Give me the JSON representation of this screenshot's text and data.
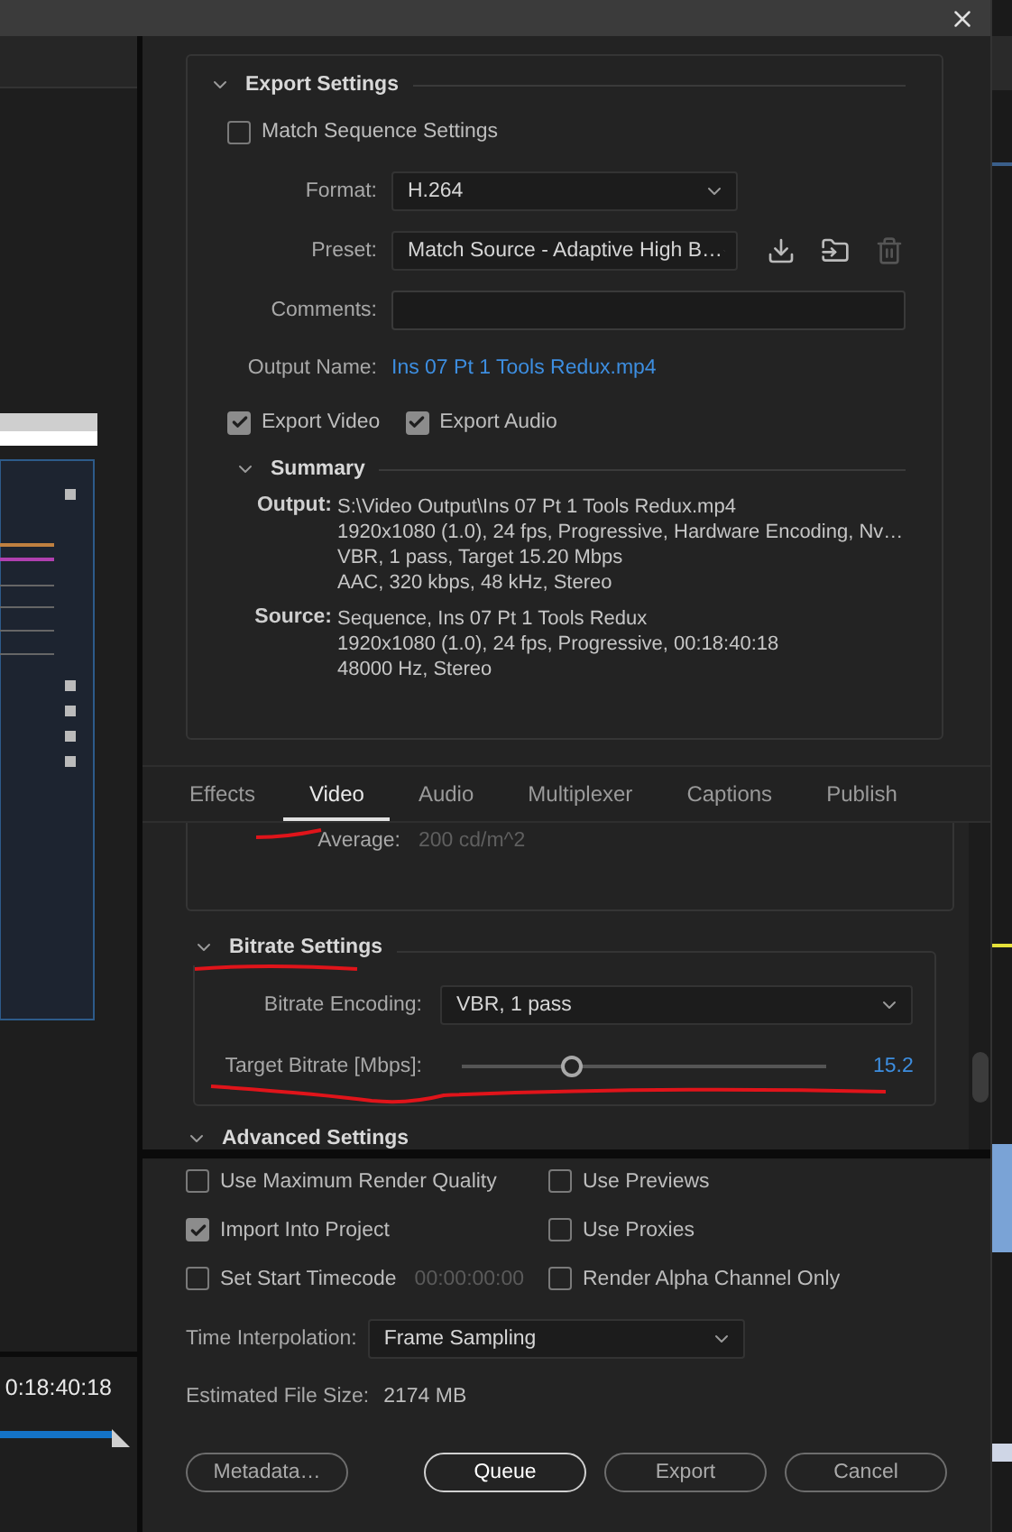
{
  "background_app": {
    "timecode": "0:18:40:18"
  },
  "export_settings": {
    "title": "Export Settings",
    "expanded": true,
    "match_sequence": {
      "label": "Match Sequence Settings",
      "checked": false
    },
    "format": {
      "label": "Format:",
      "value": "H.264"
    },
    "preset": {
      "label": "Preset:",
      "value": "Match Source - Adaptive High B…"
    },
    "comments": {
      "label": "Comments:"
    },
    "output_name": {
      "label": "Output Name:",
      "value": "Ins 07 Pt 1 Tools Redux.mp4"
    },
    "exports": [
      {
        "label": "Export Video",
        "checked": true
      },
      {
        "label": "Export Audio",
        "checked": true
      }
    ],
    "summary": {
      "title": "Summary",
      "expanded": true,
      "entries": [
        {
          "label": "Output:",
          "lines": [
            "S:\\Video Output\\Ins 07 Pt 1 Tools Redux.mp4",
            "1920x1080 (1.0), 24 fps, Progressive, Hardware Encoding, Nv…",
            "VBR, 1 pass, Target 15.20 Mbps",
            "AAC, 320 kbps, 48 kHz, Stereo"
          ]
        },
        {
          "label": "Source:",
          "lines": [
            "Sequence, Ins 07 Pt 1 Tools Redux",
            "1920x1080 (1.0), 24 fps, Progressive, 00:18:40:18",
            "48000 Hz, Stereo"
          ]
        }
      ]
    }
  },
  "tabs": [
    {
      "label": "Effects",
      "selected": false
    },
    {
      "label": "Video",
      "selected": true
    },
    {
      "label": "Audio",
      "selected": false
    },
    {
      "label": "Multiplexer",
      "selected": false
    },
    {
      "label": "Captions",
      "selected": false
    },
    {
      "label": "Publish",
      "selected": false
    }
  ],
  "video_settings": {
    "average": {
      "label": "Average:",
      "value": "200  cd/m^2",
      "disabled": true
    },
    "bitrate": {
      "title": "Bitrate Settings",
      "expanded": true,
      "encoding": {
        "label": "Bitrate Encoding:",
        "value": "VBR, 1 pass"
      },
      "target": {
        "label": "Target Bitrate [Mbps]:",
        "level": 0.3,
        "reading": "15.2"
      }
    },
    "next_section": {
      "title": "Advanced Settings",
      "expanded": true
    }
  },
  "options": [
    {
      "label": "Use Maximum Render Quality",
      "checked": false
    },
    {
      "label": "Use Previews",
      "checked": false
    },
    {
      "label": "Import Into Project",
      "checked": true
    },
    {
      "label": "Use Proxies",
      "checked": false
    },
    {
      "label": "Set Start Timecode",
      "checked": false,
      "timecode": "00:00:00:00"
    },
    {
      "label": "Render Alpha Channel Only",
      "checked": false
    }
  ],
  "time_interpolation": {
    "label": "Time Interpolation:",
    "value": "Frame Sampling"
  },
  "estimated_size": {
    "label": "Estimated File Size:",
    "value": "2174 MB"
  },
  "buttons": [
    {
      "label": "Metadata…",
      "kind": "secondary"
    },
    {
      "label": "Queue",
      "kind": "primary"
    },
    {
      "label": "Export",
      "kind": "secondary"
    },
    {
      "label": "Cancel",
      "kind": "secondary"
    }
  ]
}
